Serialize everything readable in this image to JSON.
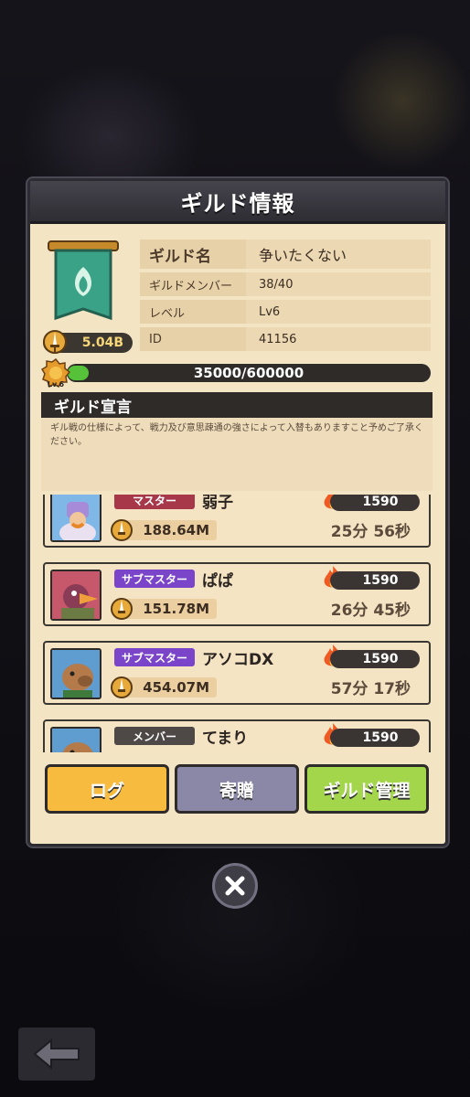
{
  "panel": {
    "title": "ギルド情報"
  },
  "guild": {
    "power": "5.04B",
    "info": [
      {
        "key": "ギルド名",
        "value": "争いたくない"
      },
      {
        "key": "ギルドメンバー",
        "value": "38/40"
      },
      {
        "key": "レベル",
        "value": "Lv6"
      },
      {
        "key": "ID",
        "value": "41156"
      }
    ],
    "level_badge": "Lv.6",
    "exp": "35000/600000",
    "exp_progress": 0.058
  },
  "declaration": {
    "title": "ギルド宣言",
    "text": "ギル戦の仕様によって、戦力及び意思疎通の強さによって入替もありますこと予めご了承ください。"
  },
  "members": [
    {
      "role": "マスター",
      "name": "弱子",
      "power": "188.64M",
      "score": "1590",
      "time": "25分 56秒"
    },
    {
      "role": "サブマスター",
      "name": "ぱぱ",
      "power": "151.78M",
      "score": "1590",
      "time": "26分 45秒"
    },
    {
      "role": "サブマスター",
      "name": "アソコDX",
      "power": "454.07M",
      "score": "1590",
      "time": "57分 17秒"
    },
    {
      "role": "メンバー",
      "name": "てまり",
      "power": "",
      "score": "1590",
      "time": ""
    }
  ],
  "buttons": {
    "log": "ログ",
    "donate": "寄贈",
    "manage": "ギルド管理"
  },
  "colors": {
    "accent_yellow": "#f6bb3f",
    "accent_green": "#a3d64a",
    "accent_gray": "#8b88a7",
    "master": "#a6384a",
    "submaster": "#7a45c8"
  },
  "icons": {
    "close": "close-x-icon",
    "back": "back-arrow-icon",
    "fire": "flame-icon",
    "sword": "sword-power-icon"
  }
}
